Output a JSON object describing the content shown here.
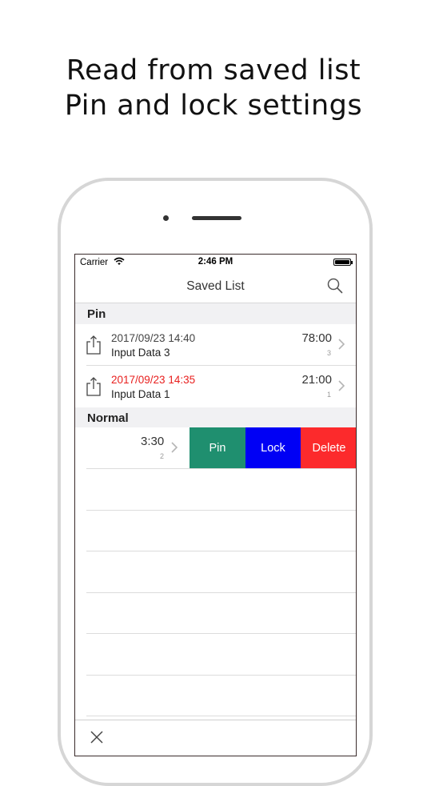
{
  "promo": {
    "line1": "Read from saved list",
    "line2": "Pin and lock settings"
  },
  "status": {
    "carrier": "Carrier",
    "time": "2:46 PM"
  },
  "nav": {
    "title": "Saved List",
    "search_icon": "search-icon"
  },
  "sections": {
    "pin": "Pin",
    "normal": "Normal"
  },
  "pinned_rows": [
    {
      "date": "2017/09/23 14:40",
      "name": "Input Data 3",
      "time": "78:00",
      "count": "3",
      "date_color": "#444444"
    },
    {
      "date": "2017/09/23 14:35",
      "name": "Input Data 1",
      "time": "21:00",
      "count": "1",
      "date_color": "#e8201f"
    }
  ],
  "normal_rows": [
    {
      "time": "3:30",
      "count": "2"
    }
  ],
  "swipe_actions": {
    "pin": "Pin",
    "lock": "Lock",
    "delete": "Delete",
    "colors": {
      "pin": "#1f8f6f",
      "lock": "#0000f5",
      "delete": "#fc2a2c"
    }
  },
  "toolbar": {
    "close_icon": "close-icon"
  }
}
